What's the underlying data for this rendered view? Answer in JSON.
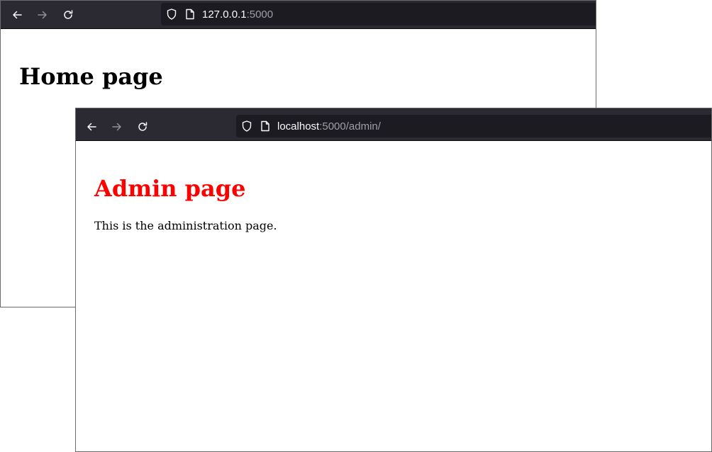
{
  "windows": {
    "home": {
      "url": {
        "host": "127.0.0.1",
        "rest": ":5000"
      },
      "page": {
        "heading": "Home page",
        "heading_color": "#000000"
      }
    },
    "admin": {
      "url": {
        "host": "localhost",
        "rest": ":5000/admin/"
      },
      "page": {
        "heading": "Admin page",
        "heading_color": "#ff0000",
        "text": "This is the administration page."
      }
    }
  },
  "toolbar": {
    "icons": {
      "back": "back-arrow-icon",
      "forward": "forward-arrow-icon",
      "reload": "reload-icon",
      "shield": "tracking-protection-shield-icon",
      "page": "page-document-icon"
    },
    "colors": {
      "background": "#2b2a33",
      "urlbar": "#1c1b22",
      "icon_active": "#fbfbfe",
      "icon_disabled": "#8f8f9d"
    }
  }
}
